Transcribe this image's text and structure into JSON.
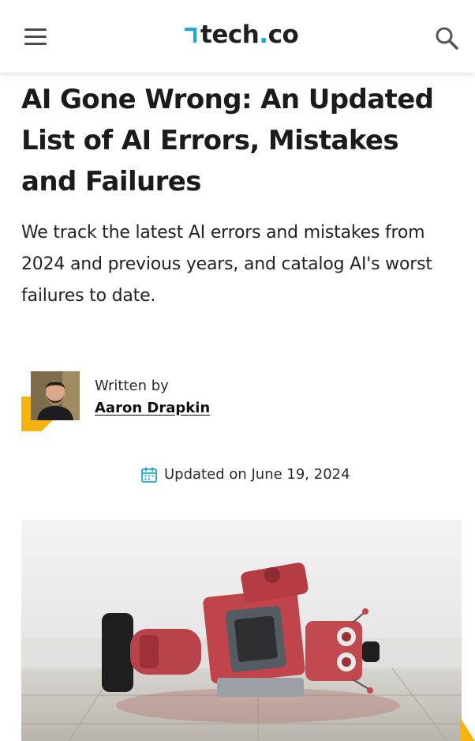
{
  "header": {
    "menu_icon": "hamburger-menu-icon",
    "logo": {
      "main": "tech",
      "dot": ".",
      "suffix": "co",
      "accent_color": "#1aa8d8"
    },
    "search_icon": "search-icon"
  },
  "article": {
    "title": "AI Gone Wrong: An Updated List of AI Errors, Mistakes and Failures",
    "subtitle": "We track the latest AI errors and mistakes from 2024 and previous years, and catalog AI's worst failures to date.",
    "author": {
      "label": "Written by",
      "name": "Aaron Drapkin"
    },
    "updated": {
      "icon": "calendar-icon",
      "text": "Updated on June 19, 2024"
    },
    "hero_image": "broken-red-toy-robot-image"
  },
  "colors": {
    "accent_blue": "#1aa8d8",
    "accent_yellow": "#f6b20f",
    "text_dark": "#1b1b1b"
  }
}
